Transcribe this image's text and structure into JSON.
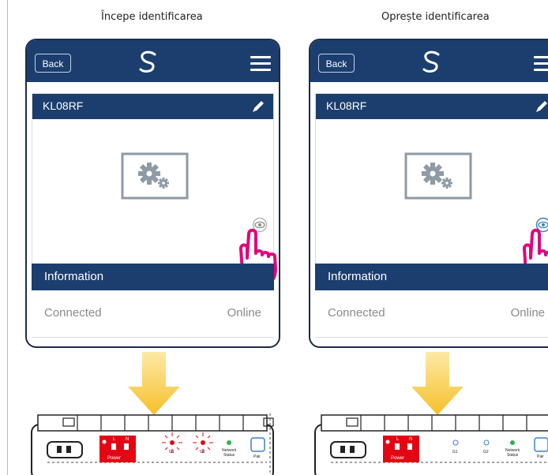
{
  "panels": [
    {
      "caption": "Începe identificarea",
      "header": {
        "back_label": "Back"
      },
      "device": {
        "name": "KL08RF"
      },
      "info": {
        "title": "Information",
        "key": "Connected",
        "value": "Online"
      },
      "board": {
        "power_label": "Power",
        "l_label": "L",
        "n_label": "N",
        "g1_label": "G1",
        "g2_label": "G2",
        "network_label": "Network",
        "status_label": "Status",
        "pair_label": "Pair",
        "leds_state": "blinking-red"
      }
    },
    {
      "caption": "Oprește identificarea",
      "header": {
        "back_label": "Back"
      },
      "device": {
        "name": "KL08RF"
      },
      "info": {
        "title": "Information",
        "key": "Connected",
        "value": "Online"
      },
      "board": {
        "power_label": "Power",
        "l_label": "L",
        "n_label": "N",
        "g1_label": "G1",
        "g2_label": "G2",
        "network_label": "Network",
        "status_label": "Status",
        "pair_label": "Pair",
        "leds_state": "off"
      }
    }
  ],
  "colors": {
    "header": "#1c3e6e",
    "arrow": "#f6c02a",
    "hand": "#e3007b",
    "board_red": "#e30613",
    "status_green": "#2fb34a",
    "pair_blue": "#3a82c6"
  }
}
